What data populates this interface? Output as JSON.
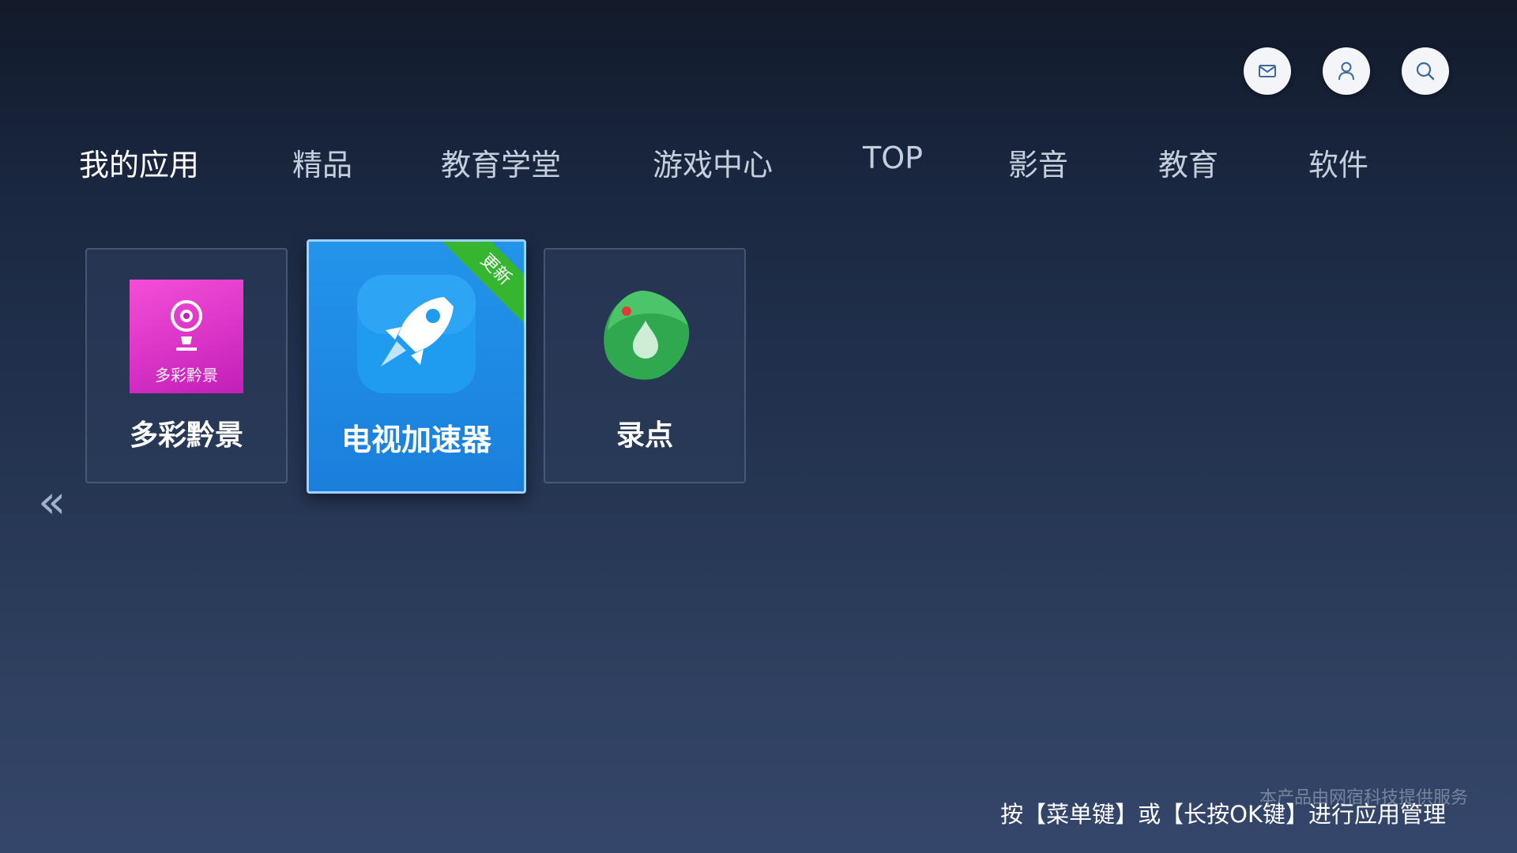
{
  "header": {
    "icons": [
      {
        "name": "mail-icon"
      },
      {
        "name": "user-icon"
      },
      {
        "name": "search-icon"
      }
    ]
  },
  "nav": {
    "tabs": [
      {
        "label": "我的应用",
        "active": true
      },
      {
        "label": "精品",
        "active": false
      },
      {
        "label": "教育学堂",
        "active": false
      },
      {
        "label": "游戏中心",
        "active": false
      },
      {
        "label": "TOP",
        "active": false
      },
      {
        "label": "影音",
        "active": false
      },
      {
        "label": "教育",
        "active": false
      },
      {
        "label": "软件",
        "active": false
      }
    ]
  },
  "apps": [
    {
      "label": "多彩黔景",
      "icon_text": "多彩黔景",
      "icon": "duocai-app-icon"
    },
    {
      "label": "电视加速器",
      "badge": "更新",
      "icon": "rocket-icon",
      "focused": true
    },
    {
      "label": "录点",
      "icon": "ludian-app-icon"
    }
  ],
  "footer": {
    "hint": "按【菜单键】或【长按OK键】进行应用管理",
    "service": "本产品由网宿科技提供服务"
  },
  "colors": {
    "focus_blue": "#1a86e0",
    "badge_green": "#36b531",
    "app_pink": "#e43fd0",
    "app_green": "#2fa84f"
  }
}
